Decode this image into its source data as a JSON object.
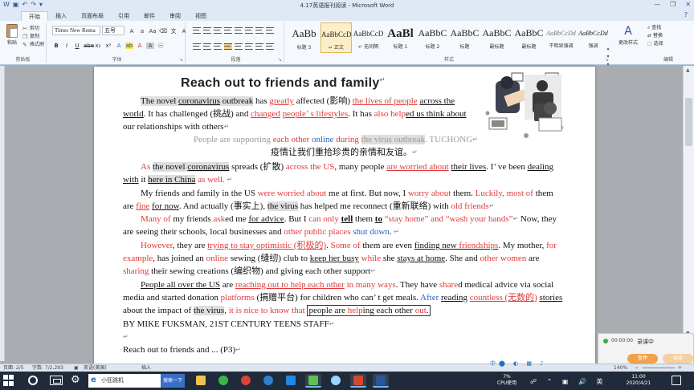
{
  "window": {
    "title": "4.17英语报刊阅读 - Microsoft Word",
    "help_icon": "?"
  },
  "ribbon_tabs": [
    "开始",
    "插入",
    "页面布局",
    "引用",
    "邮件",
    "审阅",
    "视图"
  ],
  "clipboard": {
    "paste_label": "粘贴",
    "cut_label": "剪切",
    "copy_label": "复制",
    "format_painter_label": "格式刷",
    "group_label": "剪贴板"
  },
  "font": {
    "name": "Times New Roma",
    "size": "五号",
    "group_label": "字体"
  },
  "paragraph": {
    "group_label": "段落"
  },
  "styles": {
    "group_label": "样式",
    "items": [
      {
        "sample": "AaBb",
        "name": "标题 3"
      },
      {
        "sample": "AaBbCcD",
        "name": "↵ 正文"
      },
      {
        "sample": "AaBbCcD",
        "name": "↵ 无间隔"
      },
      {
        "sample": "AaBl",
        "name": "标题 1"
      },
      {
        "sample": "AaBbC",
        "name": "标题 2"
      },
      {
        "sample": "AaBbC",
        "name": "标题"
      },
      {
        "sample": "AaBbC",
        "name": "副标题"
      },
      {
        "sample": "AaBbC",
        "name": "副标题"
      },
      {
        "sample": "AaBbCcDd",
        "name": "不明显强调"
      },
      {
        "sample": "AaBbCcDd",
        "name": "强调"
      }
    ],
    "change_styles_label": "更改样式"
  },
  "editing": {
    "group_label": "编辑",
    "find_label": "查找",
    "replace_label": "替换",
    "select_label": "选择"
  },
  "document": {
    "heading": "Reach out to friends and family",
    "footer_line": "Reach out to friends and ... (P3)"
  },
  "statusbar": {
    "page": "页面: 2/5",
    "words": "字数: 7/2,293",
    "language": "英语(美国)",
    "mode": "插入",
    "zoom": "140%"
  },
  "recording": {
    "time": "00:00:00",
    "status": "录课中",
    "pause_label": "暂停",
    "stop_label": "结束"
  },
  "taskbar": {
    "search_text": "小狂跳机",
    "search_button": "搜索一下",
    "cpu_percent": "7%",
    "cpu_label": "CPU使用",
    "ime": "中",
    "time": "11:00",
    "date": "2020/4/21"
  },
  "colors": {
    "accent": "#2b579a",
    "red_highlight": "#e03a3a",
    "blue_text": "#2b64c8",
    "taskbar": "#1f2a3a"
  }
}
